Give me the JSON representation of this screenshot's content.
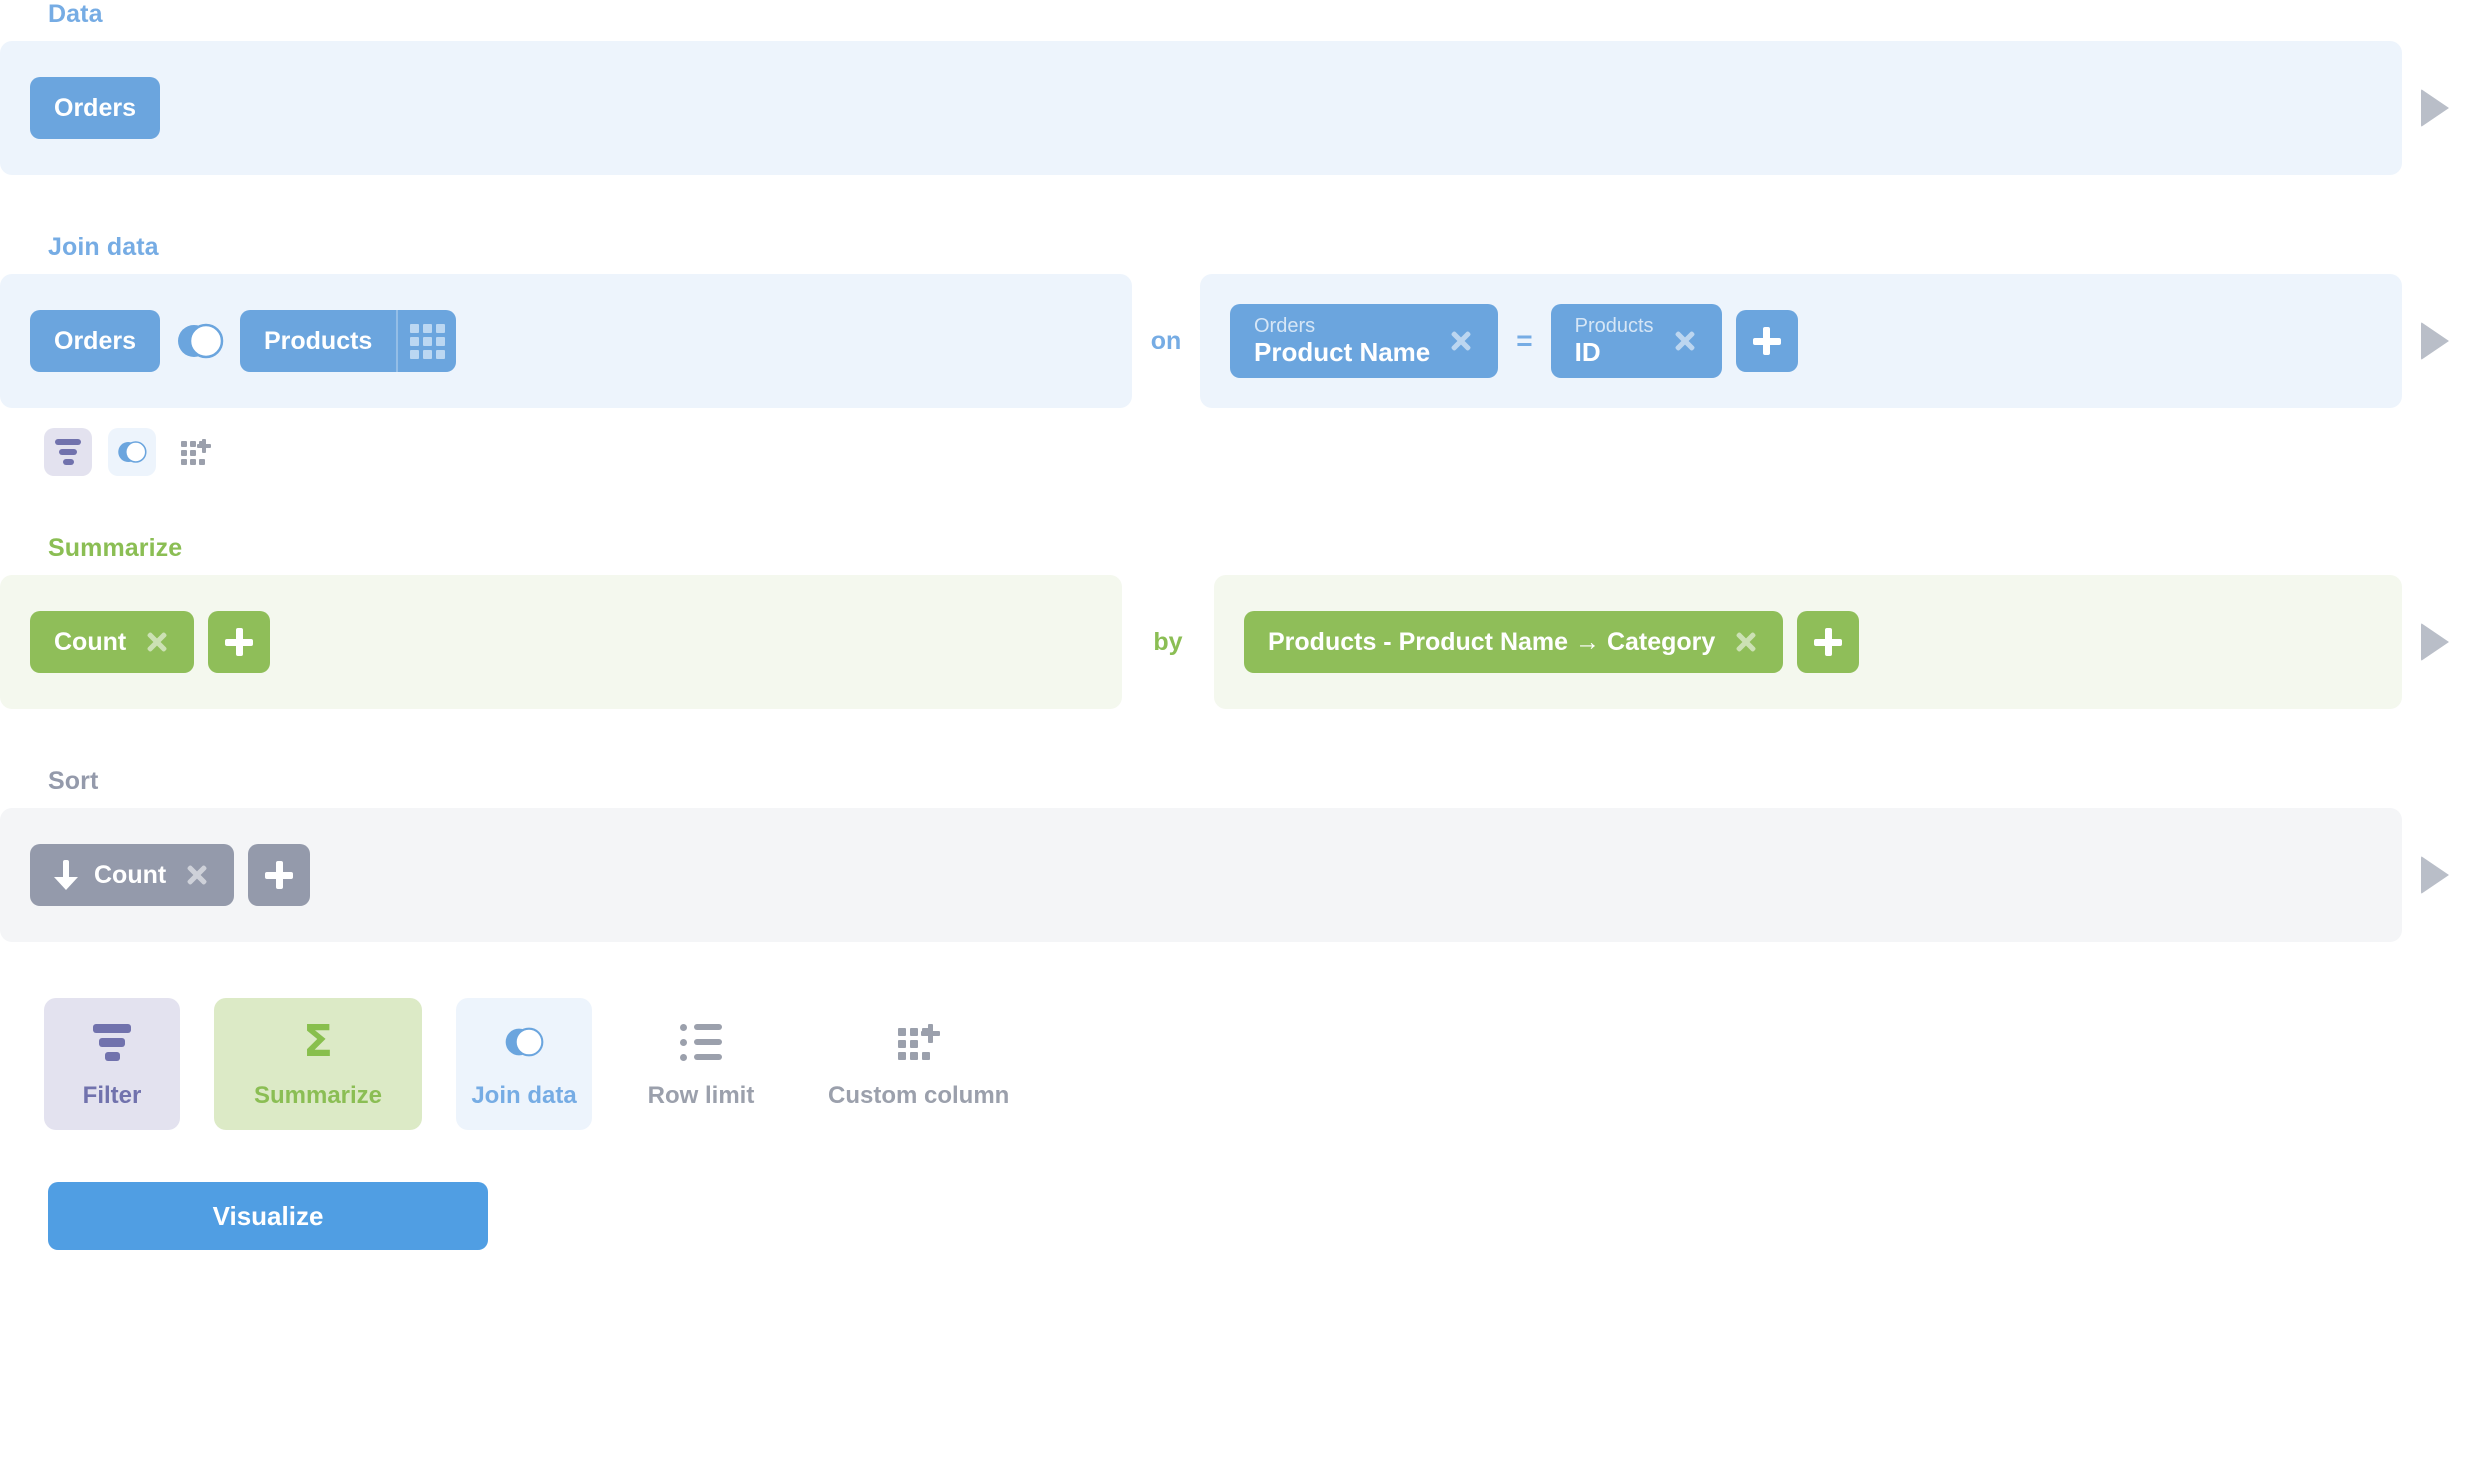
{
  "sections": {
    "data": {
      "label": "Data",
      "table": "Orders"
    },
    "join": {
      "label": "Join data",
      "left_table": "Orders",
      "right_table": "Products",
      "join_type_icon": "venn-left-join-icon",
      "on_label": "on",
      "equals_label": "=",
      "condition": {
        "left": {
          "table": "Orders",
          "field": "Product Name"
        },
        "right": {
          "table": "Products",
          "field": "ID"
        }
      },
      "mini_actions": [
        {
          "name": "filter-icon",
          "icon": "funnel-icon"
        },
        {
          "name": "join-icon",
          "icon": "venn-icon"
        },
        {
          "name": "custom-column-icon",
          "icon": "grid-plus-icon"
        }
      ]
    },
    "summarize": {
      "label": "Summarize",
      "aggregation": "Count",
      "by_label": "by",
      "breakout": "Products - Product Name → Category"
    },
    "sort": {
      "label": "Sort",
      "field": "Count",
      "direction": "descending",
      "direction_icon": "arrow-down-icon"
    }
  },
  "actions": [
    {
      "label": "Filter",
      "icon": "funnel-icon",
      "style": "purple"
    },
    {
      "label": "Summarize",
      "icon": "sigma-icon",
      "style": "green"
    },
    {
      "label": "Join data",
      "icon": "venn-icon",
      "style": "blue"
    },
    {
      "label": "Row limit",
      "icon": "list-icon",
      "style": "plain"
    },
    {
      "label": "Custom column",
      "icon": "grid-plus-icon",
      "style": "plain"
    }
  ],
  "visualize_label": "Visualize",
  "colors": {
    "blue": "#509EE3",
    "blue_chip": "#6BA5DE",
    "blue_bg": "#EDF4FC",
    "green": "#88BF4D",
    "green_chip": "#8FBE59",
    "green_bg": "#F4F8EE",
    "gray_chip": "#949AAB",
    "gray_bg": "#F4F5F7",
    "purple": "#7172AD",
    "purple_bg": "#E3E2EF"
  }
}
